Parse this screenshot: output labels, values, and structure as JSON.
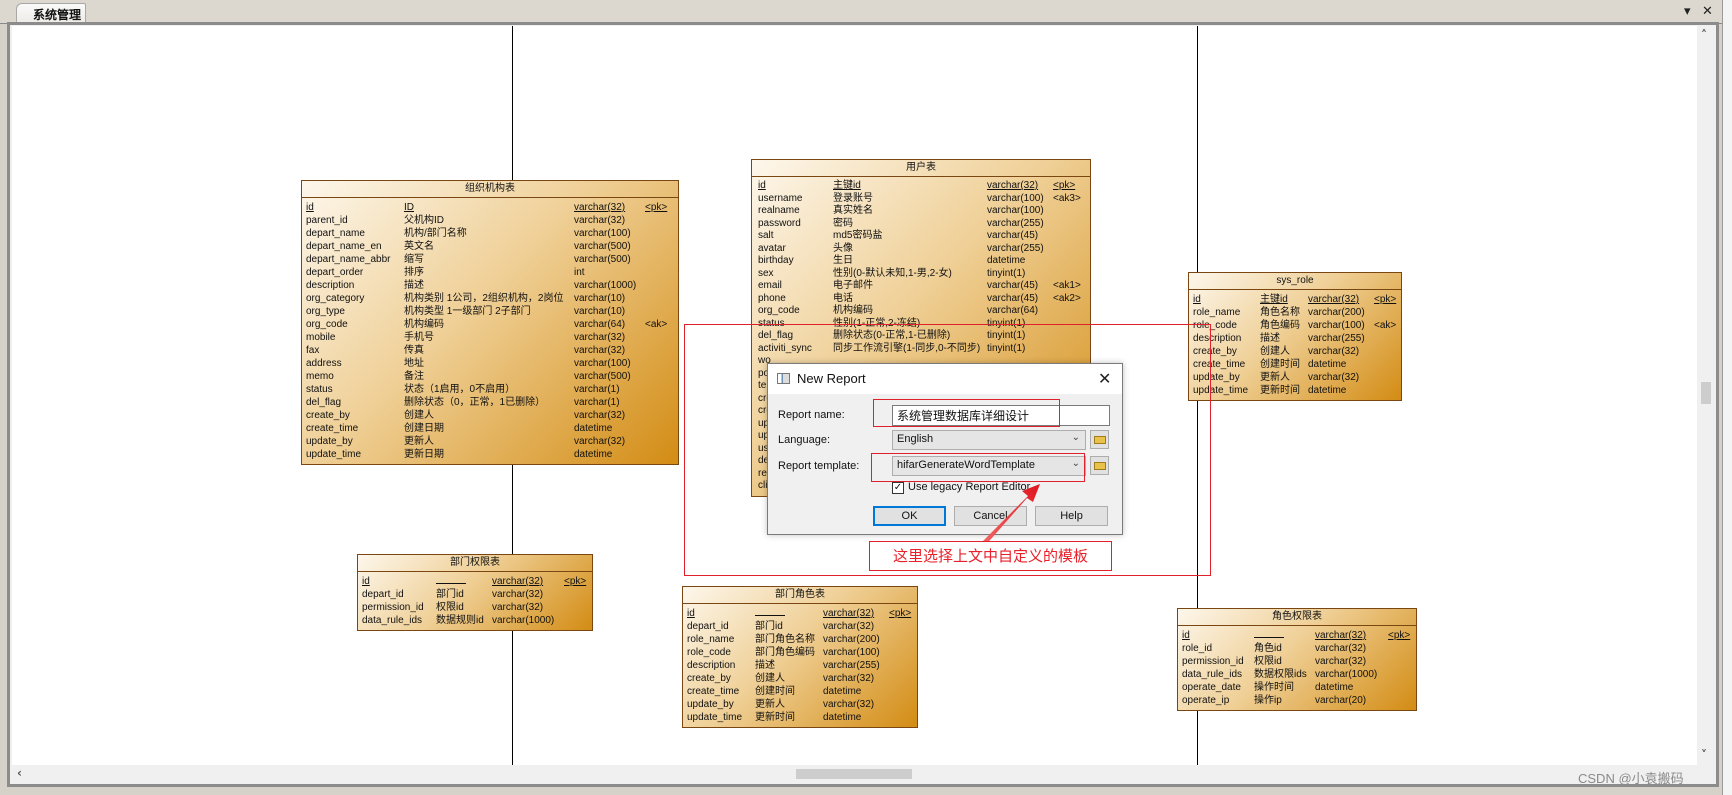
{
  "window": {
    "tab_title": "系统管理",
    "menu_icon": "dropdown-menu-icon",
    "close_icon": "close-icon"
  },
  "colors": {
    "table_gradient_start": "#fdf7ec",
    "table_gradient_end": "#d38c14",
    "annotation_red": "#e0202a",
    "focus_blue": "#0078d7"
  },
  "tables": [
    {
      "id": "org",
      "title": "组织机构表",
      "rows": [
        {
          "name": "id",
          "comment": "ID",
          "type": "varchar(32)",
          "key": "<pk>",
          "pk": true
        },
        {
          "name": "parent_id",
          "comment": "父机构ID",
          "type": "varchar(32)",
          "key": ""
        },
        {
          "name": "depart_name",
          "comment": "机构/部门名称",
          "type": "varchar(100)",
          "key": ""
        },
        {
          "name": "depart_name_en",
          "comment": "英文名",
          "type": "varchar(500)",
          "key": ""
        },
        {
          "name": "depart_name_abbr",
          "comment": "缩写",
          "type": "varchar(500)",
          "key": ""
        },
        {
          "name": "depart_order",
          "comment": "排序",
          "type": "int",
          "key": ""
        },
        {
          "name": "description",
          "comment": "描述",
          "type": "varchar(1000)",
          "key": ""
        },
        {
          "name": "org_category",
          "comment": "机构类别 1公司，2组织机构，2岗位",
          "type": "varchar(10)",
          "key": ""
        },
        {
          "name": "org_type",
          "comment": "机构类型 1一级部门 2子部门",
          "type": "varchar(10)",
          "key": ""
        },
        {
          "name": "org_code",
          "comment": "机构编码",
          "type": "varchar(64)",
          "key": "<ak>"
        },
        {
          "name": "mobile",
          "comment": "手机号",
          "type": "varchar(32)",
          "key": ""
        },
        {
          "name": "fax",
          "comment": "传真",
          "type": "varchar(32)",
          "key": ""
        },
        {
          "name": "address",
          "comment": "地址",
          "type": "varchar(100)",
          "key": ""
        },
        {
          "name": "memo",
          "comment": "备注",
          "type": "varchar(500)",
          "key": ""
        },
        {
          "name": "status",
          "comment": "状态（1启用，0不启用）",
          "type": "varchar(1)",
          "key": ""
        },
        {
          "name": "del_flag",
          "comment": "删除状态（0，正常，1已删除）",
          "type": "varchar(1)",
          "key": ""
        },
        {
          "name": "create_by",
          "comment": "创建人",
          "type": "varchar(32)",
          "key": ""
        },
        {
          "name": "create_time",
          "comment": "创建日期",
          "type": "datetime",
          "key": ""
        },
        {
          "name": "update_by",
          "comment": "更新人",
          "type": "varchar(32)",
          "key": ""
        },
        {
          "name": "update_time",
          "comment": "更新日期",
          "type": "datetime",
          "key": ""
        }
      ]
    },
    {
      "id": "user",
      "title": "用户表",
      "rows": [
        {
          "name": "id",
          "comment": "主键id",
          "type": "varchar(32)",
          "key": "<pk>",
          "pk": true
        },
        {
          "name": "username",
          "comment": "登录账号",
          "type": "varchar(100)",
          "key": "<ak3>"
        },
        {
          "name": "realname",
          "comment": "真实姓名",
          "type": "varchar(100)",
          "key": ""
        },
        {
          "name": "password",
          "comment": "密码",
          "type": "varchar(255)",
          "key": ""
        },
        {
          "name": "salt",
          "comment": "md5密码盐",
          "type": "varchar(45)",
          "key": ""
        },
        {
          "name": "avatar",
          "comment": "头像",
          "type": "varchar(255)",
          "key": ""
        },
        {
          "name": "birthday",
          "comment": "生日",
          "type": "datetime",
          "key": ""
        },
        {
          "name": "sex",
          "comment": "性别(0-默认未知,1-男,2-女)",
          "type": "tinyint(1)",
          "key": ""
        },
        {
          "name": "email",
          "comment": "电子邮件",
          "type": "varchar(45)",
          "key": "<ak1>"
        },
        {
          "name": "phone",
          "comment": "电话",
          "type": "varchar(45)",
          "key": "<ak2>"
        },
        {
          "name": "org_code",
          "comment": "机构编码",
          "type": "varchar(64)",
          "key": ""
        },
        {
          "name": "status",
          "comment": "性别(1-正常,2-冻结)",
          "type": "tinyint(1)",
          "key": ""
        },
        {
          "name": "del_flag",
          "comment": "删除状态(0-正常,1-已删除)",
          "type": "tinyint(1)",
          "key": ""
        },
        {
          "name": "activiti_sync",
          "comment": "同步工作流引擎(1-同步,0-不同步)",
          "type": "tinyint(1)",
          "key": ""
        },
        {
          "name": "wo",
          "comment": "",
          "type": "",
          "key": ""
        },
        {
          "name": "po",
          "comment": "",
          "type": "",
          "key": ""
        },
        {
          "name": "tel",
          "comment": "",
          "type": "",
          "key": ""
        },
        {
          "name": "cre",
          "comment": "",
          "type": "",
          "key": ""
        },
        {
          "name": "cre",
          "comment": "",
          "type": "",
          "key": ""
        },
        {
          "name": "up",
          "comment": "",
          "type": "",
          "key": ""
        },
        {
          "name": "up",
          "comment": "",
          "type": "",
          "key": ""
        },
        {
          "name": "us",
          "comment": "",
          "type": "",
          "key": ""
        },
        {
          "name": "de",
          "comment": "",
          "type": "",
          "key": ""
        },
        {
          "name": "re",
          "comment": "",
          "type": "",
          "key": ""
        },
        {
          "name": "cli",
          "comment": "",
          "type": "",
          "key": ""
        }
      ]
    },
    {
      "id": "sys_role",
      "title": "sys_role",
      "rows": [
        {
          "name": "id",
          "comment": "主键id",
          "type": "varchar(32)",
          "key": "<pk>",
          "pk": true
        },
        {
          "name": "role_name",
          "comment": "角色名称",
          "type": "varchar(200)",
          "key": ""
        },
        {
          "name": "role_code",
          "comment": "角色编码",
          "type": "varchar(100)",
          "key": "<ak>"
        },
        {
          "name": "description",
          "comment": "描述",
          "type": "varchar(255)",
          "key": ""
        },
        {
          "name": "create_by",
          "comment": "创建人",
          "type": "varchar(32)",
          "key": ""
        },
        {
          "name": "create_time",
          "comment": "创建时间",
          "type": "datetime",
          "key": ""
        },
        {
          "name": "update_by",
          "comment": "更新人",
          "type": "varchar(32)",
          "key": ""
        },
        {
          "name": "update_time",
          "comment": "更新时间",
          "type": "datetime",
          "key": ""
        }
      ]
    },
    {
      "id": "depart_perm",
      "title": "部门权限表",
      "rows": [
        {
          "name": "id",
          "comment": "",
          "type": "varchar(32)",
          "key": "<pk>",
          "pk": true
        },
        {
          "name": "depart_id",
          "comment": "部门id",
          "type": "varchar(32)",
          "key": ""
        },
        {
          "name": "permission_id",
          "comment": "权限id",
          "type": "varchar(32)",
          "key": ""
        },
        {
          "name": "data_rule_ids",
          "comment": "数据规则id",
          "type": "varchar(1000)",
          "key": ""
        }
      ]
    },
    {
      "id": "depart_role",
      "title": "部门角色表",
      "rows": [
        {
          "name": "id",
          "comment": "",
          "type": "varchar(32)",
          "key": "<pk>",
          "pk": true
        },
        {
          "name": "depart_id",
          "comment": "部门id",
          "type": "varchar(32)",
          "key": ""
        },
        {
          "name": "role_name",
          "comment": "部门角色名称",
          "type": "varchar(200)",
          "key": ""
        },
        {
          "name": "role_code",
          "comment": "部门角色编码",
          "type": "varchar(100)",
          "key": ""
        },
        {
          "name": "description",
          "comment": "描述",
          "type": "varchar(255)",
          "key": ""
        },
        {
          "name": "create_by",
          "comment": "创建人",
          "type": "varchar(32)",
          "key": ""
        },
        {
          "name": "create_time",
          "comment": "创建时间",
          "type": "datetime",
          "key": ""
        },
        {
          "name": "update_by",
          "comment": "更新人",
          "type": "varchar(32)",
          "key": ""
        },
        {
          "name": "update_time",
          "comment": "更新时间",
          "type": "datetime",
          "key": ""
        }
      ]
    },
    {
      "id": "role_perm",
      "title": "角色权限表",
      "rows": [
        {
          "name": "id",
          "comment": "",
          "type": "varchar(32)",
          "key": "<pk>",
          "pk": true
        },
        {
          "name": "role_id",
          "comment": "角色id",
          "type": "varchar(32)",
          "key": ""
        },
        {
          "name": "permission_id",
          "comment": "权限id",
          "type": "varchar(32)",
          "key": ""
        },
        {
          "name": "data_rule_ids",
          "comment": "数据权限ids",
          "type": "varchar(1000)",
          "key": ""
        },
        {
          "name": "operate_date",
          "comment": "操作时间",
          "type": "datetime",
          "key": ""
        },
        {
          "name": "operate_ip",
          "comment": "操作ip",
          "type": "varchar(20)",
          "key": ""
        }
      ]
    }
  ],
  "dialog": {
    "title": "New Report",
    "report_name_label": "Report name:",
    "report_name_value": "系统管理数据库详细设计",
    "language_label": "Language:",
    "language_value": "English",
    "template_label": "Report template:",
    "template_value": "hifarGenerateWordTemplate",
    "legacy_label": "Use legacy Report Editor",
    "legacy_checked": true,
    "ok": "OK",
    "cancel": "Cancel",
    "help": "Help"
  },
  "annotation": {
    "note": "这里选择上文中自定义的模板"
  },
  "watermark": "CSDN @小袁搬码"
}
